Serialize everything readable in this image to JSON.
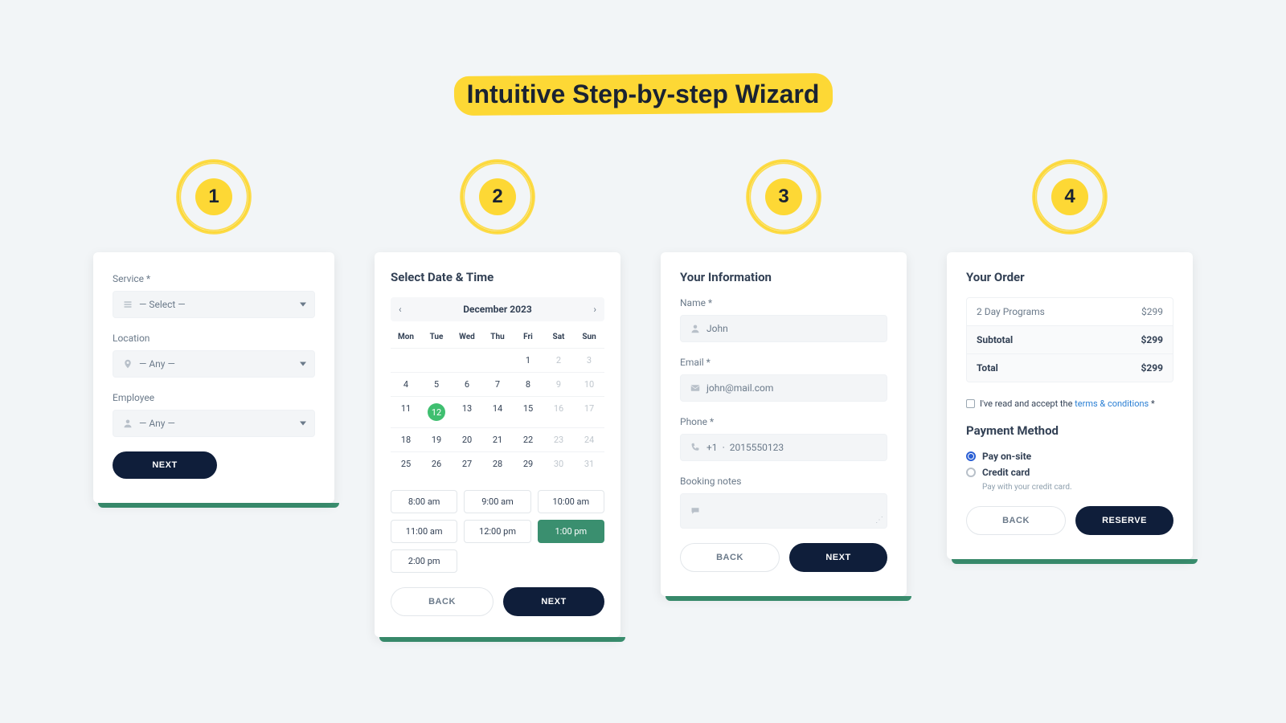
{
  "title": "Intuitive Step-by-step Wizard",
  "steps": {
    "s1": "1",
    "s2": "2",
    "s3": "3",
    "s4": "4"
  },
  "step1": {
    "service": {
      "label": "Service *",
      "value": "— Select —"
    },
    "location": {
      "label": "Location",
      "value": "— Any —"
    },
    "employee": {
      "label": "Employee",
      "value": "— Any —"
    },
    "next": "NEXT"
  },
  "step2": {
    "heading": "Select Date & Time",
    "month": "December 2023",
    "dow": [
      "Mon",
      "Tue",
      "Wed",
      "Thu",
      "Fri",
      "Sat",
      "Sun"
    ],
    "days": [
      {
        "d": "",
        "m": true
      },
      {
        "d": "",
        "m": true
      },
      {
        "d": "",
        "m": true
      },
      {
        "d": "",
        "m": true
      },
      {
        "d": "1"
      },
      {
        "d": "2",
        "m": true
      },
      {
        "d": "3",
        "m": true
      },
      {
        "d": "4"
      },
      {
        "d": "5"
      },
      {
        "d": "6"
      },
      {
        "d": "7"
      },
      {
        "d": "8"
      },
      {
        "d": "9",
        "m": true
      },
      {
        "d": "10",
        "m": true
      },
      {
        "d": "11"
      },
      {
        "d": "12",
        "sel": true
      },
      {
        "d": "13"
      },
      {
        "d": "14"
      },
      {
        "d": "15"
      },
      {
        "d": "16",
        "m": true
      },
      {
        "d": "17",
        "m": true
      },
      {
        "d": "18"
      },
      {
        "d": "19"
      },
      {
        "d": "20"
      },
      {
        "d": "21"
      },
      {
        "d": "22"
      },
      {
        "d": "23",
        "m": true
      },
      {
        "d": "24",
        "m": true
      },
      {
        "d": "25"
      },
      {
        "d": "26"
      },
      {
        "d": "27"
      },
      {
        "d": "28"
      },
      {
        "d": "29"
      },
      {
        "d": "30",
        "m": true
      },
      {
        "d": "31",
        "m": true
      }
    ],
    "slots": [
      {
        "t": "8:00 am"
      },
      {
        "t": "9:00 am"
      },
      {
        "t": "10:00 am"
      },
      {
        "t": "11:00 am"
      },
      {
        "t": "12:00 pm"
      },
      {
        "t": "1:00 pm",
        "sel": true
      },
      {
        "t": "2:00 pm"
      }
    ],
    "back": "BACK",
    "next": "NEXT"
  },
  "step3": {
    "heading": "Your Information",
    "name": {
      "label": "Name *",
      "value": "John"
    },
    "email": {
      "label": "Email *",
      "value": "john@mail.com"
    },
    "phone": {
      "label": "Phone *",
      "code": "+1",
      "value": "2015550123"
    },
    "notes": {
      "label": "Booking notes"
    },
    "back": "BACK",
    "next": "NEXT"
  },
  "step4": {
    "heading": "Your Order",
    "item": {
      "name": "2 Day Programs",
      "price": "$299"
    },
    "subtotal": {
      "label": "Subtotal",
      "price": "$299"
    },
    "total": {
      "label": "Total",
      "price": "$299"
    },
    "terms_pre": "I've read and accept the ",
    "terms_link": "terms & conditions",
    "terms_post": " *",
    "payment_heading": "Payment Method",
    "pay_onsite": "Pay on-site",
    "credit_card": "Credit card",
    "credit_hint": "Pay with your credit card.",
    "back": "BACK",
    "reserve": "RESERVE"
  }
}
